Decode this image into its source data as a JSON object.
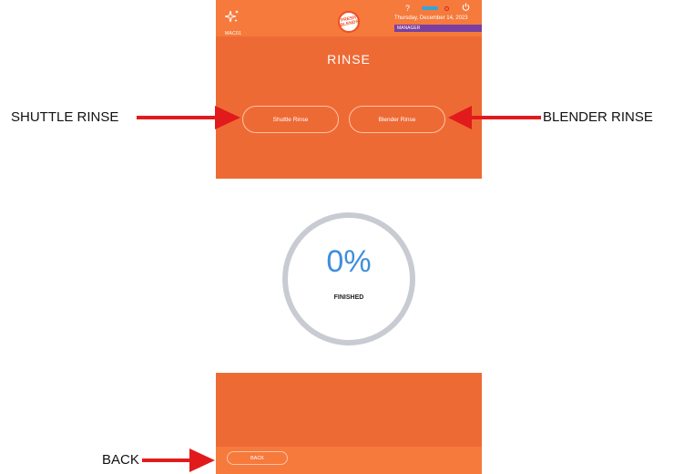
{
  "device": {
    "machine_id": "MAC01",
    "logo_text": "FRESH BLENDS",
    "help_label": "?",
    "date": "Thursday, December 14, 2023",
    "role": "MANAGER",
    "title": "RINSE",
    "buttons": {
      "shuttle": "Shuttle Rinse",
      "blender": "Blender Rinse"
    },
    "progress": {
      "value_text": "0%",
      "fraction": 0,
      "label": "FINISHED"
    },
    "back_label": "BACK"
  },
  "annotations": {
    "shuttle": "SHUTTLE RINSE",
    "blender": "BLENDER RINSE",
    "back": "BACK"
  },
  "icons": {
    "sparkle": "sparkle-icon",
    "help": "help-icon",
    "connection": "connection-bar-icon",
    "status": "status-dot-icon",
    "power": "power-icon"
  },
  "colors": {
    "brand_orange": "#EE6A35",
    "header_orange": "#F57A3C",
    "progress_blue": "#3E8EDC",
    "ring_gray": "#C8CCD2",
    "role_purple": "#7A3FA0",
    "arrow_red": "#E11B1B"
  }
}
